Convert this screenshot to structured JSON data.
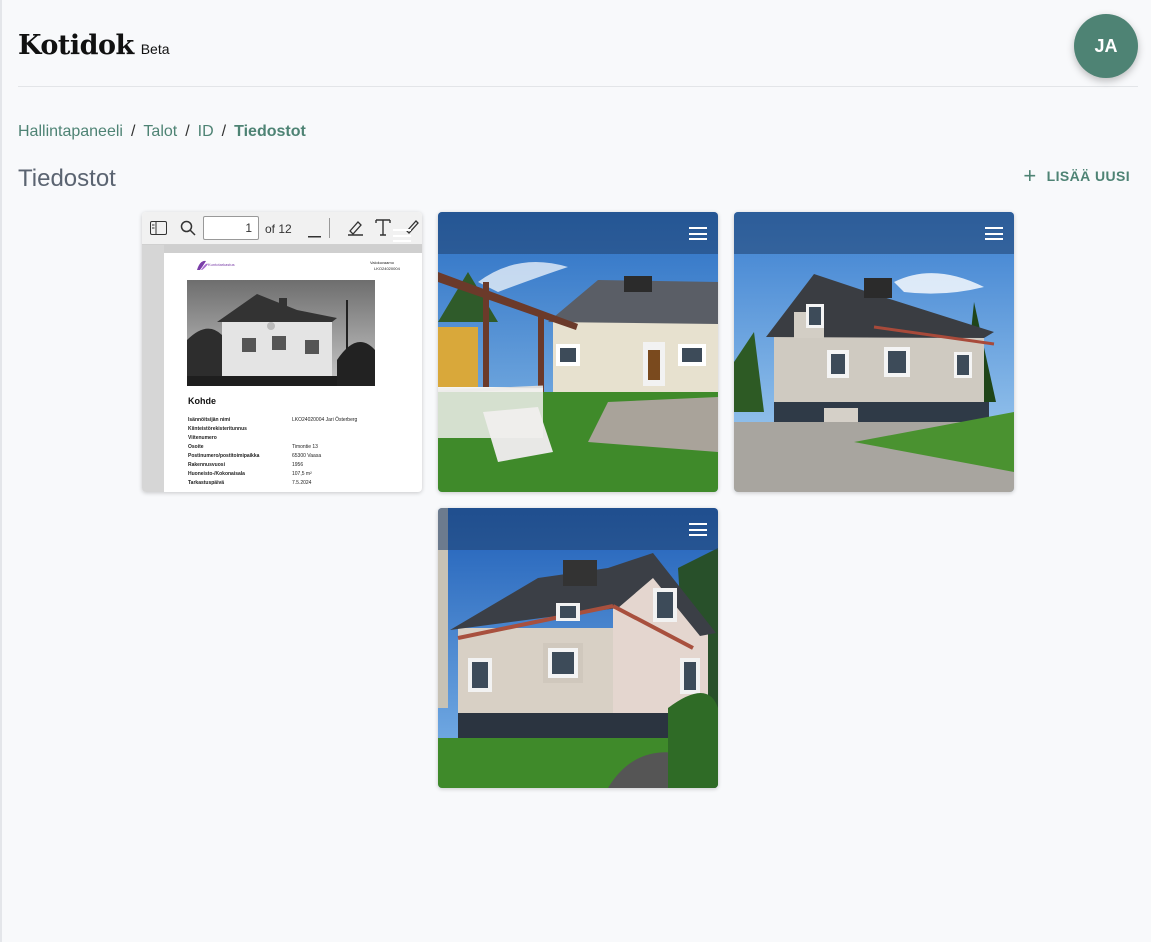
{
  "app": {
    "logo": "Kotidok",
    "badge": "Beta",
    "user_initials": "JA"
  },
  "breadcrumb": {
    "items": [
      "Hallintapaneeli",
      "Talot",
      "ID"
    ],
    "current": "Tiedostot"
  },
  "page": {
    "title": "Tiedostot",
    "add_label": "LISÄÄ UUSI"
  },
  "pdf_viewer": {
    "page_number": "1",
    "page_count_label": "of 12",
    "doc": {
      "logo_text": "Kuntotarkastus",
      "header_right_1": "Valokuvaamo",
      "header_right_2": "LKO24020004",
      "section": "Kohde",
      "rows": [
        {
          "label": "Isännöitsijän nimi",
          "value": "LKO24020004 Jari Österberg"
        },
        {
          "label": "Kiinteistörekisteritunnus",
          "value": ""
        },
        {
          "label": "Viitenumero",
          "value": ""
        },
        {
          "label": "Osoite",
          "value": "Timontie 13"
        },
        {
          "label": "Postinumero/postitoimipaikka",
          "value": "65300 Vaasa"
        },
        {
          "label": "Rakennusvuosi",
          "value": "1956"
        },
        {
          "label": "Huoneisto-/Kokonaisala",
          "value": "107,5 m²"
        },
        {
          "label": "Tarkastuspäivä",
          "value": "7.5.2024"
        }
      ]
    }
  },
  "files": [
    {
      "kind": "pdf"
    },
    {
      "kind": "image",
      "subject": "house-front-with-pergola"
    },
    {
      "kind": "image",
      "subject": "house-side-gravel-yard"
    },
    {
      "kind": "image",
      "subject": "house-corner-blue-sky"
    }
  ],
  "colors": {
    "accent": "#4e8374",
    "background": "#f8f9fb",
    "card_overlay": "#20416e"
  }
}
